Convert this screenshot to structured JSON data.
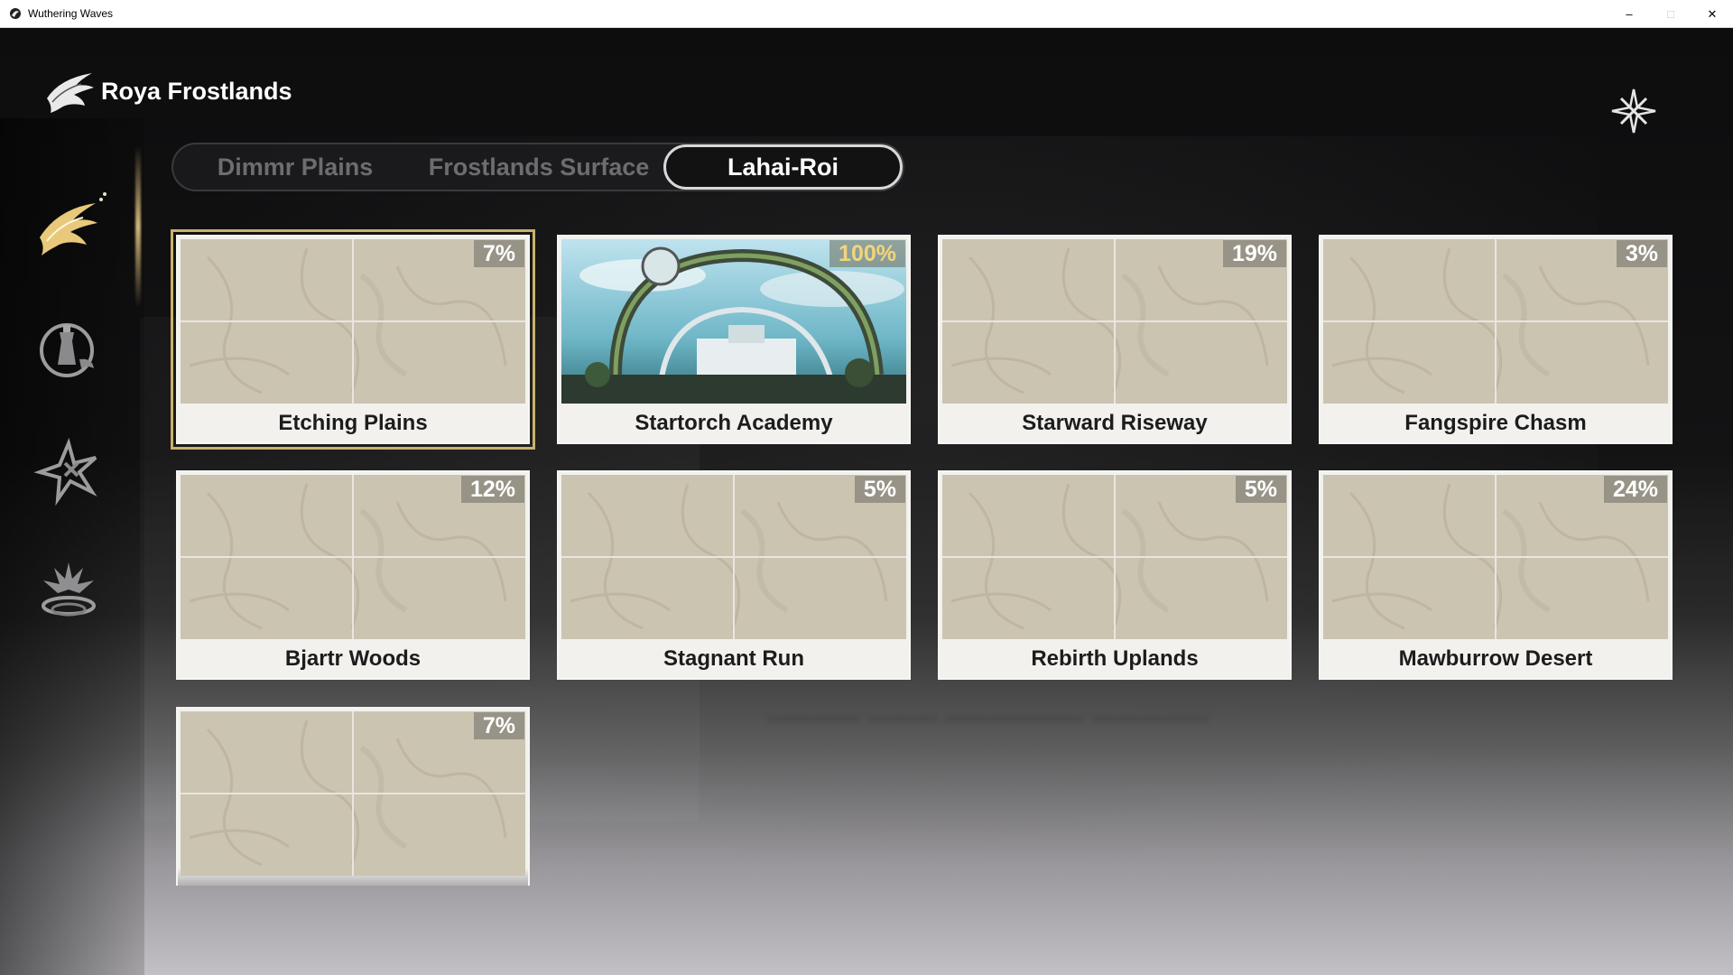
{
  "window": {
    "title": "Wuthering Waves",
    "controls": [
      "–",
      "□",
      "✕"
    ]
  },
  "header": {
    "region_name": "Roya Frostlands",
    "logo_icon": "faction-bird-emblem-icon",
    "close_icon": "star-close-icon"
  },
  "sidebar": {
    "items": [
      {
        "name": "faction-bird-emblem",
        "active": true
      },
      {
        "name": "bell-tower-emblem",
        "active": false
      },
      {
        "name": "star-burst-emblem",
        "active": false
      },
      {
        "name": "serpent-crest-emblem",
        "active": false
      }
    ]
  },
  "tabs": [
    {
      "label": "Dimmr Plains",
      "active": false
    },
    {
      "label": "Frostlands Surface",
      "active": false
    },
    {
      "label": "Lahai-Roi",
      "active": true
    }
  ],
  "areas": [
    {
      "name": "Etching Plains",
      "progress": "7%",
      "selected": true,
      "image": "map"
    },
    {
      "name": "Startorch Academy",
      "progress": "100%",
      "selected": false,
      "image": "photo"
    },
    {
      "name": "Starward Riseway",
      "progress": "19%",
      "selected": false,
      "image": "map"
    },
    {
      "name": "Fangspire Chasm",
      "progress": "3%",
      "selected": false,
      "image": "map"
    },
    {
      "name": "Bjartr Woods",
      "progress": "12%",
      "selected": false,
      "image": "map"
    },
    {
      "name": "Stagnant Run",
      "progress": "5%",
      "selected": false,
      "image": "map"
    },
    {
      "name": "Rebirth Uplands",
      "progress": "5%",
      "selected": false,
      "image": "map"
    },
    {
      "name": "Mawburrow Desert",
      "progress": "24%",
      "selected": false,
      "image": "map"
    },
    {
      "name": "",
      "progress": "7%",
      "selected": false,
      "image": "map"
    }
  ],
  "colors": {
    "selected_outline": "#c9b26a",
    "complete_progress": "#f3d57a",
    "card_bg": "#f2f1ee",
    "map_tile": "#cbc4b1"
  }
}
